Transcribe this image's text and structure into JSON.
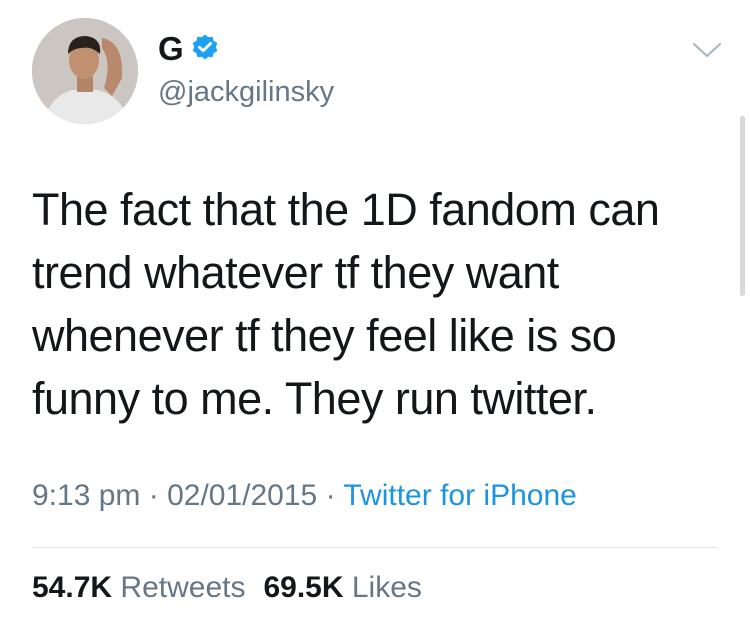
{
  "author": {
    "display_name": "G",
    "handle": "@jackgilinsky",
    "verified": true,
    "avatar_icon": "profile-photo",
    "verified_icon": "verified-badge-icon",
    "verified_color": "#1da1f2"
  },
  "tweet": {
    "text": "The fact that the 1D fandom can trend whatever tf they want whenever tf they feel like is so funny to me. They run twitter.",
    "time": "9:13 pm",
    "date": "02/01/2015",
    "separator": "·",
    "source": "Twitter for iPhone"
  },
  "stats": {
    "retweets_count": "54.7K",
    "retweets_label": "Retweets",
    "likes_count": "69.5K",
    "likes_label": "Likes"
  },
  "colors": {
    "text": "#14171a",
    "secondary": "#657786",
    "link": "#1b95e0",
    "divider": "#e1e8ed"
  },
  "menu_icon": "chevron-down-icon"
}
